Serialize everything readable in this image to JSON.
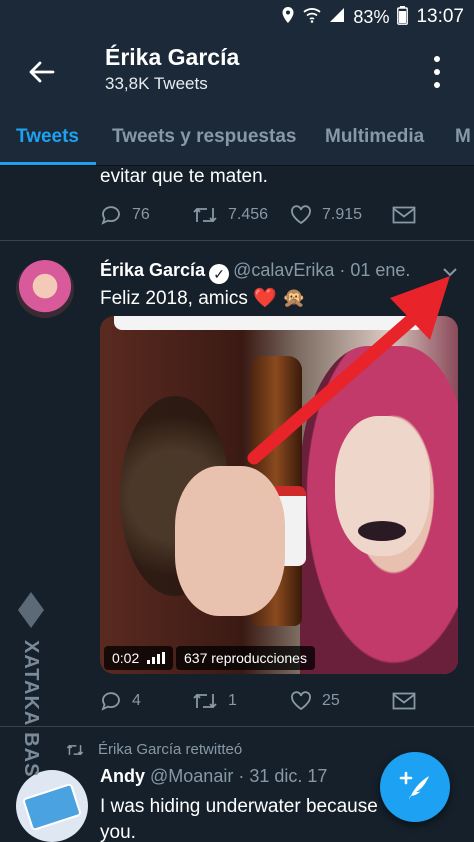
{
  "status_bar": {
    "battery": "83%",
    "time": "13:07"
  },
  "header": {
    "title": "Érika García",
    "subtitle": "33,8K Tweets"
  },
  "tabs": [
    {
      "label": "Tweets",
      "active": true
    },
    {
      "label": "Tweets y respuestas",
      "active": false
    },
    {
      "label": "Multimedia",
      "active": false
    },
    {
      "label": "M",
      "active": false
    }
  ],
  "previous_tweet": {
    "text_tail": "evitar que te maten.",
    "replies": "76",
    "retweets": "7.456",
    "likes": "7.915"
  },
  "tweet": {
    "name": "Érika García",
    "handle_date": "@calavErika · 01 ene.",
    "text": "Feliz 2018, amics",
    "emoji": "❤️ 🙊",
    "video_time": "0:02",
    "video_views": "637 reproducciones",
    "replies": "4",
    "retweets": "1",
    "likes": "25"
  },
  "next_tweet": {
    "retweet_note": "Érika García retwitteó",
    "name": "Andy",
    "handle_date": "@Moanair · 31 dic. 17",
    "text_line1": "I was hiding underwater because",
    "text_line2": "you."
  },
  "watermark": {
    "text": "XATAKA BAS"
  },
  "colors": {
    "background": "#15202b",
    "bar": "#1c2938",
    "accent": "#1da1f2",
    "muted": "#8899a6",
    "heart": "#e0245e",
    "arrow": "#e8232a"
  }
}
